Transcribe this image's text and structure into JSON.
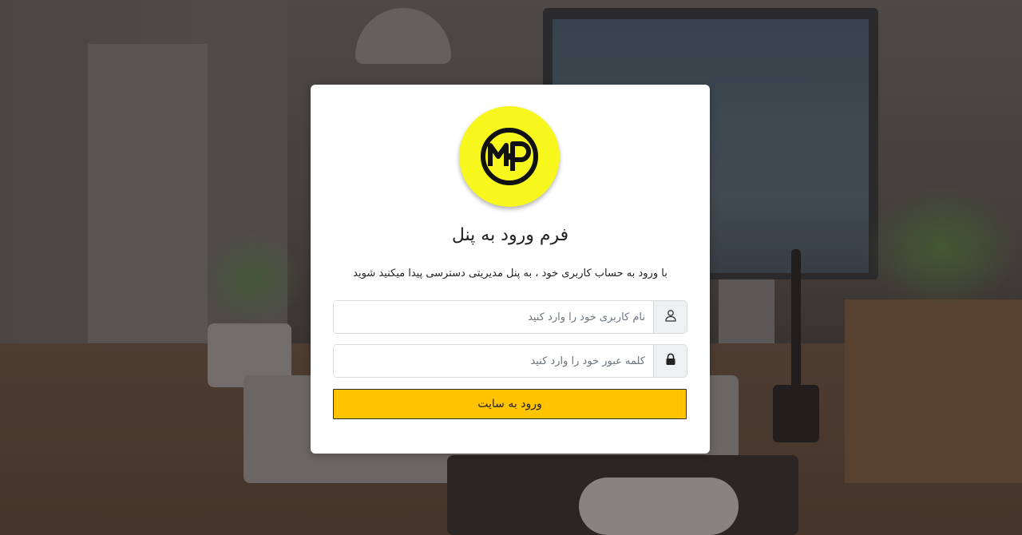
{
  "login": {
    "title": "فرم ورود به پنل",
    "subtitle": "با ورود به حساب کاربری خود ، به پنل مدیریتی دسترسی پیدا میکنید شوید",
    "username_placeholder": "نام کاربری خود را وارد کنید",
    "username_value": "",
    "password_placeholder": "کلمه عبور خود را وارد کنید",
    "password_value": "",
    "submit_label": "ورود به سایت"
  },
  "icons": {
    "logo": "mp-monogram-logo",
    "username": "user-icon",
    "password": "lock-icon"
  },
  "colors": {
    "logo_background": "#f7f71e",
    "submit_background": "#ffc300",
    "card_background": "#ffffff"
  }
}
